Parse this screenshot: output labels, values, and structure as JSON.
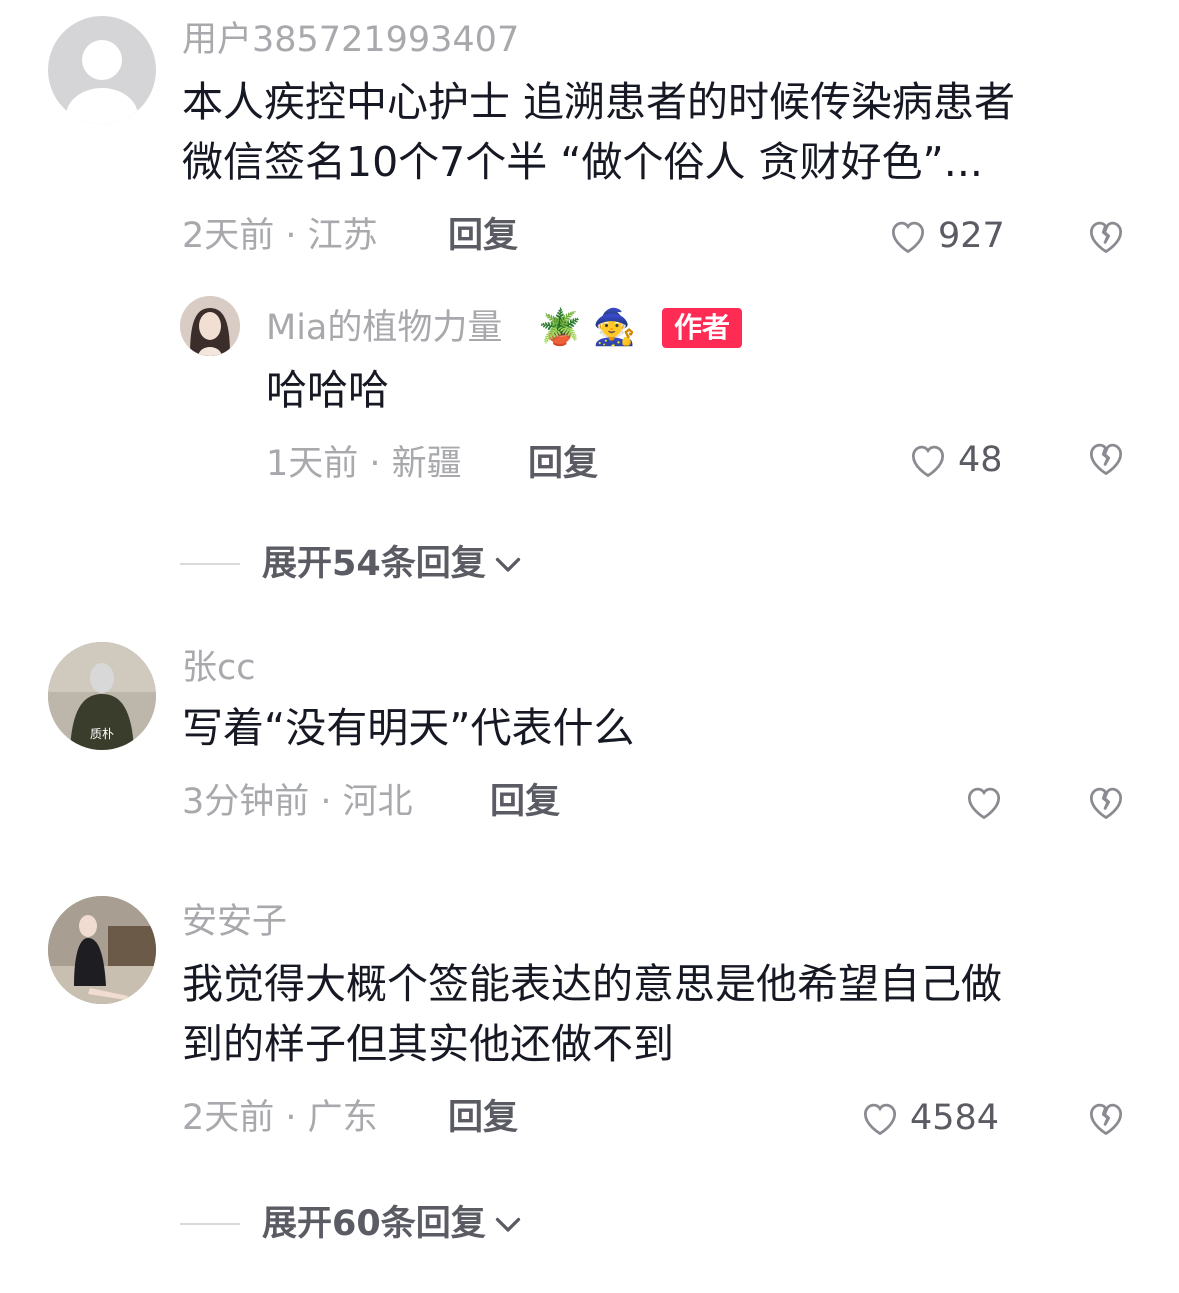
{
  "comments": [
    {
      "username": "用户385721993407",
      "text_line1": "本人疾控中心护士 追溯患者的时候传染病患者",
      "text_line2": "微信签名10个7个半 “做个俗人 贪财好色”...",
      "time": "2天前 · 江苏",
      "reply_label": "回复",
      "likes": "927",
      "avatar_icon": "default-user-avatar"
    },
    {
      "username": "张cc",
      "text_line1": "写着“没有明天”代表什么",
      "time": "3分钟前 · 河北",
      "reply_label": "回复",
      "likes": "",
      "avatar_watermark": "质朴"
    },
    {
      "username": "安安子",
      "text_line1": "我觉得大概个签能表达的意思是他希望自己做",
      "text_line2": "到的样子但其实他还做不到",
      "time": "2天前 · 广东",
      "reply_label": "回复",
      "likes": "4584"
    }
  ],
  "author_reply": {
    "username": "Mia的植物力量",
    "emojis": "🪴 🧙",
    "badge": "作者",
    "text": "哈哈哈",
    "time": "1天前 · 新疆",
    "reply_label": "回复",
    "likes": "48"
  },
  "expanders": [
    {
      "label": "展开54条回复"
    },
    {
      "label": "展开60条回复"
    }
  ],
  "colors": {
    "accent": "#fe2c55",
    "text_primary": "#161823",
    "text_secondary": "#a8a9ad",
    "text_action": "#5a5b63"
  }
}
